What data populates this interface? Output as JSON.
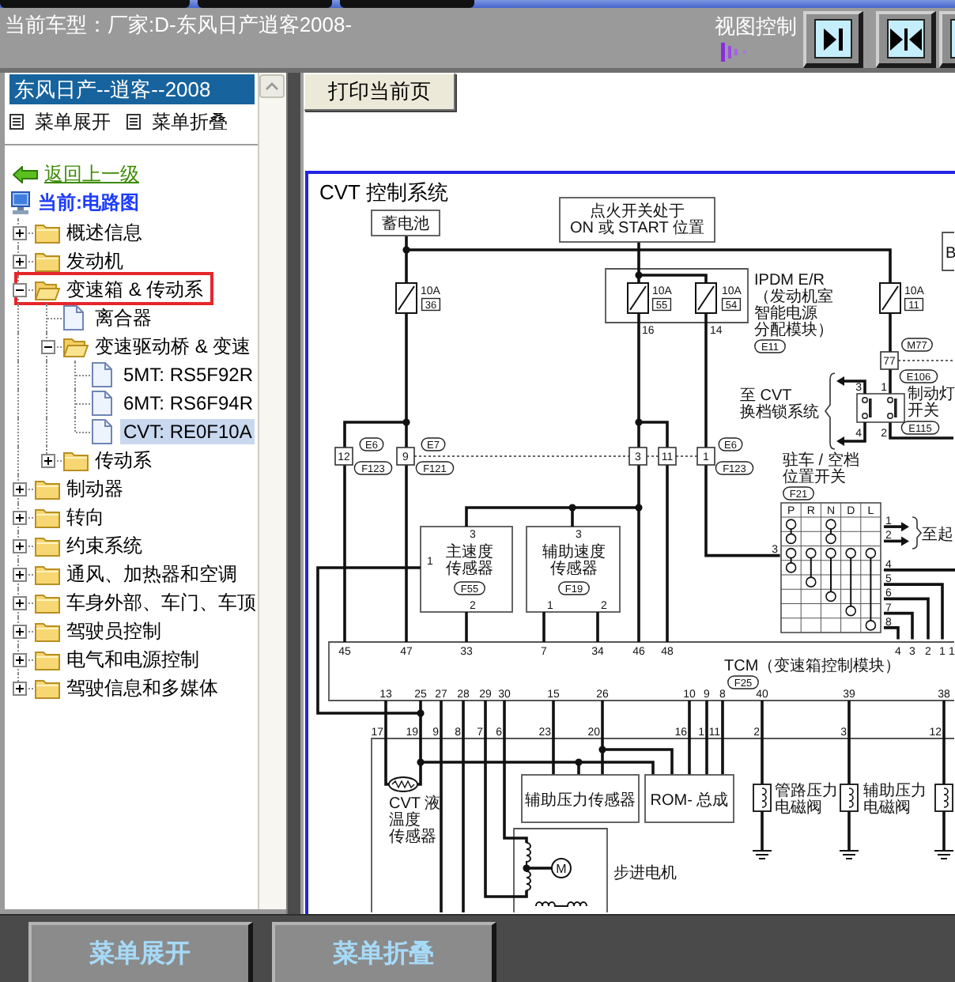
{
  "header": {
    "vehicle": "当前车型：厂家:D-东风日产逍客2008-",
    "view_control": "视图控制"
  },
  "sidebar": {
    "model": {
      "label": "东风日产--逍客--2008",
      "selected": true
    },
    "menu_actions": [
      "菜单展开",
      "菜单折叠"
    ],
    "back_link": "返回上一级",
    "current": "当前:电路图",
    "tree": [
      {
        "kind": "folder",
        "label": "概述信息",
        "expanded": false,
        "selected": false,
        "highlighted": false
      },
      {
        "kind": "folder",
        "label": "发动机",
        "expanded": false,
        "selected": false,
        "highlighted": false
      },
      {
        "kind": "folder",
        "label": "变速箱 & 传动系",
        "expanded": true,
        "selected": false,
        "highlighted": true,
        "children": [
          {
            "kind": "document",
            "label": "离合器",
            "selected": false,
            "highlighted": false
          },
          {
            "kind": "folder",
            "label": "变速驱动桥 & 变速",
            "expanded": true,
            "selected": false,
            "highlighted": false,
            "children": [
              {
                "kind": "document",
                "label": "5MT: RS5F92R",
                "selected": false,
                "highlighted": false
              },
              {
                "kind": "document",
                "label": "6MT: RS6F94R",
                "selected": false,
                "highlighted": false
              },
              {
                "kind": "document",
                "label": "CVT: RE0F10A",
                "selected": true,
                "highlighted": false
              }
            ]
          },
          {
            "kind": "folder",
            "label": "传动系",
            "expanded": false,
            "selected": false,
            "highlighted": false
          }
        ]
      },
      {
        "kind": "folder",
        "label": "制动器",
        "expanded": false,
        "selected": false,
        "highlighted": false
      },
      {
        "kind": "folder",
        "label": "转向",
        "expanded": false,
        "selected": false,
        "highlighted": false
      },
      {
        "kind": "folder",
        "label": "约束系统",
        "expanded": false,
        "selected": false,
        "highlighted": false
      },
      {
        "kind": "folder",
        "label": "通风、加热器和空调",
        "expanded": false,
        "selected": false,
        "highlighted": false
      },
      {
        "kind": "folder",
        "label": "车身外部、车门、车顶",
        "expanded": false,
        "selected": false,
        "highlighted": false
      },
      {
        "kind": "folder",
        "label": "驾驶员控制",
        "expanded": false,
        "selected": false,
        "highlighted": false
      },
      {
        "kind": "folder",
        "label": "电气和电源控制",
        "expanded": false,
        "selected": false,
        "highlighted": false
      },
      {
        "kind": "folder",
        "label": "驾驶信息和多媒体",
        "expanded": false,
        "selected": false,
        "highlighted": false
      }
    ]
  },
  "toolbar": {
    "print_button": "打印当前页"
  },
  "diagram": {
    "labels": [
      {
        "kind": "title",
        "text": "CVT 控制系统"
      },
      {
        "kind": "box",
        "lines": [
          "蓄电池"
        ]
      },
      {
        "kind": "box",
        "lines": [
          "点火开关处于",
          "ON 或 START 位置"
        ]
      },
      {
        "kind": "text",
        "lines": [
          "B"
        ]
      },
      {
        "kind": "pin",
        "text": "10A"
      },
      {
        "kind": "boxed",
        "text": "36"
      },
      {
        "kind": "pin",
        "text": "10A"
      },
      {
        "kind": "boxed",
        "text": "55"
      },
      {
        "kind": "pin",
        "text": "10A"
      },
      {
        "kind": "boxed",
        "text": "54"
      },
      {
        "kind": "text",
        "lines": [
          "IPDM E/R",
          "（发动机室",
          "智能电源",
          "分配模块）"
        ]
      },
      {
        "kind": "pin",
        "text": "10A"
      },
      {
        "kind": "boxed",
        "text": "11"
      },
      {
        "kind": "pin",
        "text": "16"
      },
      {
        "kind": "pin",
        "text": "14"
      },
      {
        "kind": "tag",
        "text": "E11"
      },
      {
        "kind": "tag",
        "text": "M77"
      },
      {
        "kind": "connector",
        "text": "77"
      },
      {
        "kind": "tag",
        "text": "E106"
      },
      {
        "kind": "text",
        "lines": [
          "至 CVT",
          "换档锁系统"
        ]
      },
      {
        "kind": "pin",
        "text": "3"
      },
      {
        "kind": "pin",
        "text": "1"
      },
      {
        "kind": "text",
        "lines": [
          "制动灯",
          "开关"
        ]
      },
      {
        "kind": "pin",
        "text": "4"
      },
      {
        "kind": "pin",
        "text": "2"
      },
      {
        "kind": "tag",
        "text": "E115"
      },
      {
        "kind": "connector",
        "text": "12"
      },
      {
        "kind": "tag",
        "text": "E6"
      },
      {
        "kind": "tag",
        "text": "F123"
      },
      {
        "kind": "connector",
        "text": "9"
      },
      {
        "kind": "tag",
        "text": "E7"
      },
      {
        "kind": "tag",
        "text": "F121"
      },
      {
        "kind": "connector",
        "text": "3"
      },
      {
        "kind": "connector",
        "text": "11"
      },
      {
        "kind": "connector",
        "text": "1"
      },
      {
        "kind": "tag",
        "text": "E6"
      },
      {
        "kind": "tag",
        "text": "F123"
      },
      {
        "kind": "text",
        "lines": [
          "驻车 / 空档",
          "位置开关"
        ]
      },
      {
        "kind": "tag",
        "text": "F21"
      },
      {
        "kind": "pin",
        "text": "P"
      },
      {
        "kind": "pin",
        "text": "R"
      },
      {
        "kind": "pin",
        "text": "N"
      },
      {
        "kind": "pin",
        "text": "D"
      },
      {
        "kind": "pin",
        "text": "L"
      },
      {
        "kind": "pin",
        "text": "3"
      },
      {
        "kind": "pin",
        "text": "1"
      },
      {
        "kind": "pin",
        "text": "2"
      },
      {
        "kind": "text",
        "lines": [
          "至起"
        ]
      },
      {
        "kind": "pin",
        "text": "4"
      },
      {
        "kind": "pin",
        "text": "5"
      },
      {
        "kind": "pin",
        "text": "6"
      },
      {
        "kind": "pin",
        "text": "7"
      },
      {
        "kind": "pin",
        "text": "8"
      },
      {
        "kind": "pin",
        "text": "3"
      },
      {
        "kind": "pin",
        "text": "1"
      },
      {
        "kind": "text",
        "lines": [
          "主速度",
          "传感器"
        ]
      },
      {
        "kind": "tag",
        "text": "F55"
      },
      {
        "kind": "pin",
        "text": "2"
      },
      {
        "kind": "pin",
        "text": "3"
      },
      {
        "kind": "text",
        "lines": [
          "辅助速度",
          "传感器"
        ]
      },
      {
        "kind": "tag",
        "text": "F19"
      },
      {
        "kind": "pin",
        "text": "1"
      },
      {
        "kind": "pin",
        "text": "2"
      },
      {
        "kind": "pin",
        "text": "45"
      },
      {
        "kind": "pin",
        "text": "47"
      },
      {
        "kind": "pin",
        "text": "33"
      },
      {
        "kind": "pin",
        "text": "7"
      },
      {
        "kind": "pin",
        "text": "34"
      },
      {
        "kind": "pin",
        "text": "46"
      },
      {
        "kind": "pin",
        "text": "48"
      },
      {
        "kind": "text",
        "lines": [
          "TCM（变速箱控制模块）"
        ]
      },
      {
        "kind": "tag",
        "text": "F25"
      },
      {
        "kind": "pin",
        "text": "4"
      },
      {
        "kind": "pin",
        "text": "3"
      },
      {
        "kind": "pin",
        "text": "2"
      },
      {
        "kind": "pin",
        "text": "1"
      },
      {
        "kind": "pin",
        "text": "1"
      },
      {
        "kind": "pin",
        "text": "13"
      },
      {
        "kind": "pin",
        "text": "25"
      },
      {
        "kind": "pin",
        "text": "27"
      },
      {
        "kind": "pin",
        "text": "28"
      },
      {
        "kind": "pin",
        "text": "29"
      },
      {
        "kind": "pin",
        "text": "30"
      },
      {
        "kind": "pin",
        "text": "15"
      },
      {
        "kind": "pin",
        "text": "26"
      },
      {
        "kind": "pin",
        "text": "10"
      },
      {
        "kind": "pin",
        "text": "9"
      },
      {
        "kind": "pin",
        "text": "8"
      },
      {
        "kind": "pin",
        "text": "40"
      },
      {
        "kind": "pin",
        "text": "39"
      },
      {
        "kind": "pin",
        "text": "38"
      },
      {
        "kind": "pin",
        "text": "17"
      },
      {
        "kind": "pin",
        "text": "19"
      },
      {
        "kind": "pin",
        "text": "9"
      },
      {
        "kind": "pin",
        "text": "8"
      },
      {
        "kind": "pin",
        "text": "7"
      },
      {
        "kind": "pin",
        "text": "6"
      },
      {
        "kind": "pin",
        "text": "23"
      },
      {
        "kind": "pin",
        "text": "20"
      },
      {
        "kind": "pin",
        "text": "16"
      },
      {
        "kind": "pin",
        "text": "1"
      },
      {
        "kind": "pin",
        "text": "11"
      },
      {
        "kind": "pin",
        "text": "2"
      },
      {
        "kind": "pin",
        "text": "3"
      },
      {
        "kind": "pin",
        "text": "12"
      },
      {
        "kind": "text",
        "lines": [
          "CVT 液",
          "温度",
          "传感器"
        ]
      },
      {
        "kind": "box",
        "lines": [
          "辅助压力传感器"
        ]
      },
      {
        "kind": "box",
        "lines": [
          "ROM- 总成"
        ]
      },
      {
        "kind": "text",
        "lines": [
          "管路压力",
          "电磁阀"
        ]
      },
      {
        "kind": "text",
        "lines": [
          "辅助压力",
          "电磁阀"
        ]
      },
      {
        "kind": "circled",
        "text": "M"
      },
      {
        "kind": "text",
        "lines": [
          "步进电机"
        ]
      }
    ]
  },
  "bottom_bar": {
    "buttons": [
      "菜单展开",
      "菜单折叠"
    ]
  }
}
